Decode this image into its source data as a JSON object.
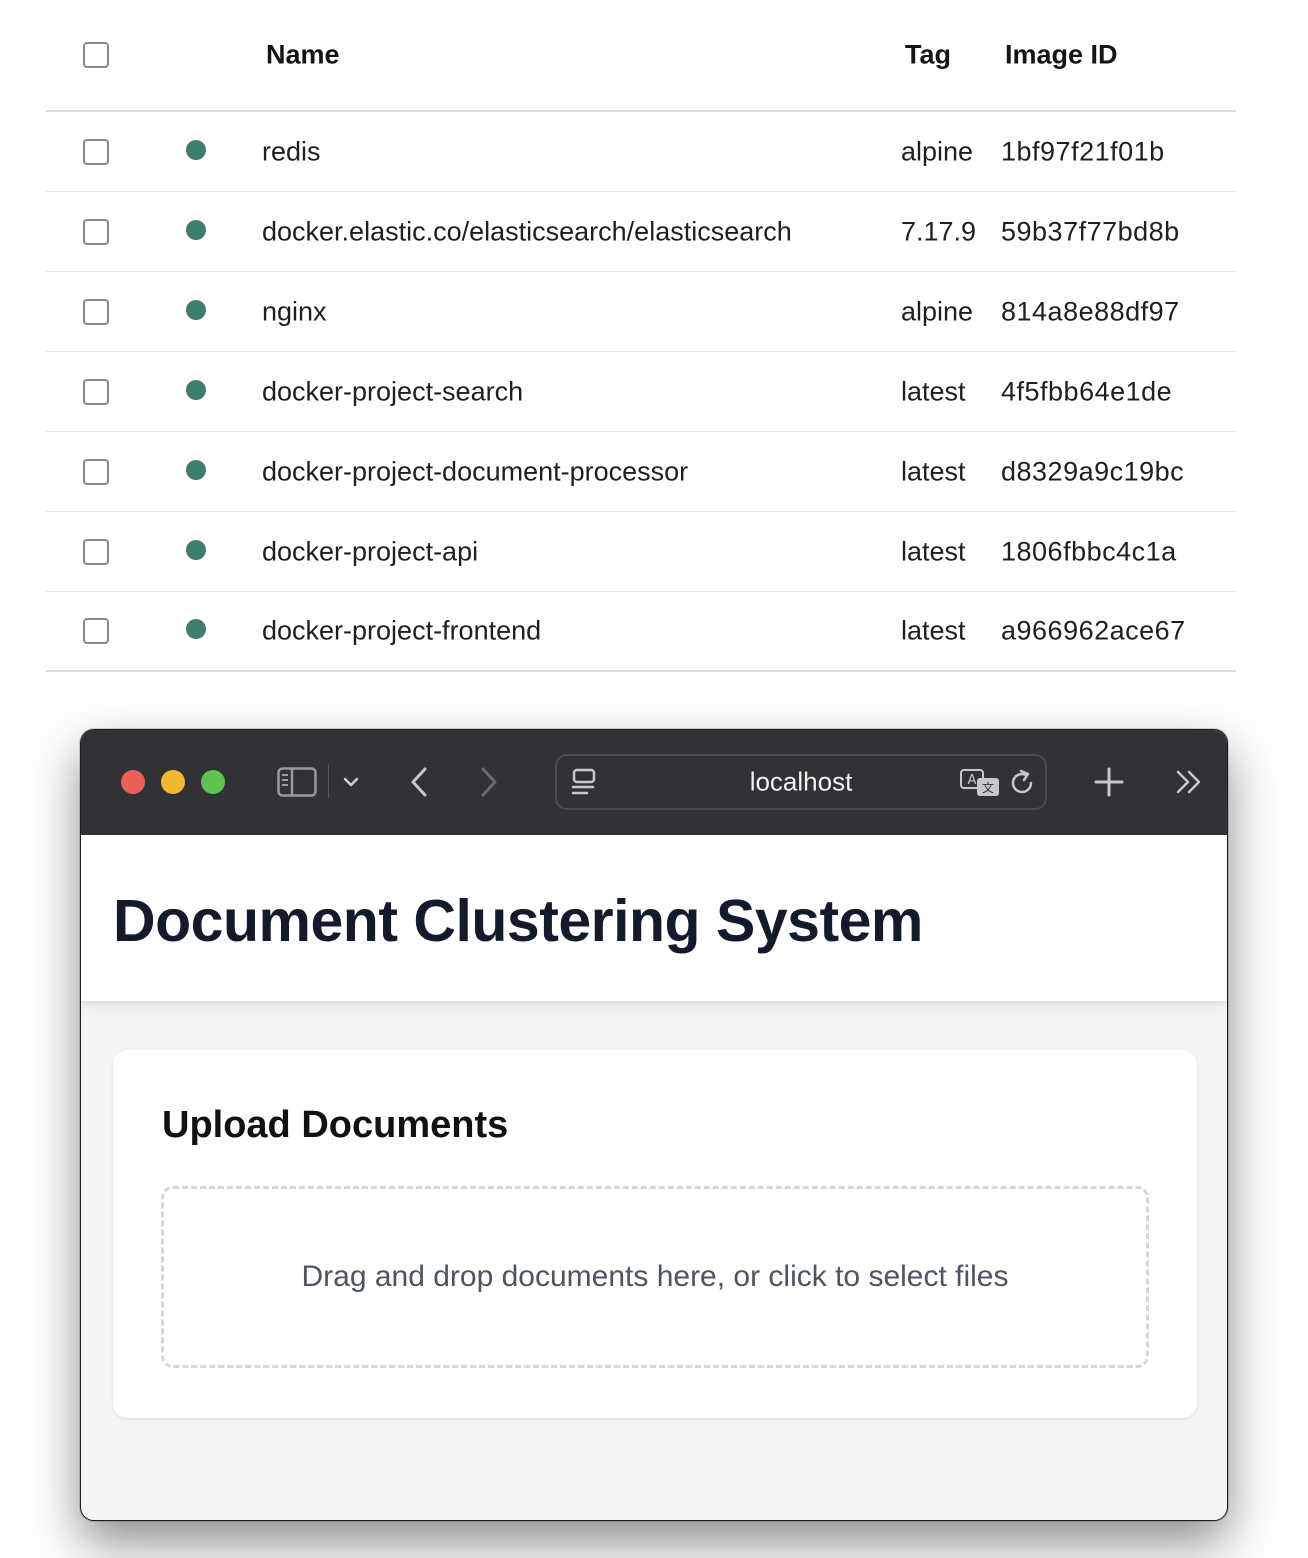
{
  "images_table": {
    "columns": {
      "name": "Name",
      "tag": "Tag",
      "image_id": "Image ID"
    },
    "status_color": "#3f7d70",
    "rows": [
      {
        "name": "redis",
        "tag": "alpine",
        "image_id": "1bf97f21f01b"
      },
      {
        "name": "docker.elastic.co/elasticsearch/elasticsearch",
        "tag": "7.17.9",
        "image_id": "59b37f77bd8b"
      },
      {
        "name": "nginx",
        "tag": "alpine",
        "image_id": "814a8e88df97"
      },
      {
        "name": "docker-project-search",
        "tag": "latest",
        "image_id": "4f5fbb64e1de"
      },
      {
        "name": "docker-project-document-processor",
        "tag": "latest",
        "image_id": "d8329a9c19bc"
      },
      {
        "name": "docker-project-api",
        "tag": "latest",
        "image_id": "1806fbbc4c1a"
      },
      {
        "name": "docker-project-frontend",
        "tag": "latest",
        "image_id": "a966962ace67"
      }
    ]
  },
  "browser": {
    "url": "localhost",
    "icons": [
      "sidebar-icon",
      "chevron-down-icon",
      "back-icon",
      "forward-icon",
      "page-icon",
      "translate-icon",
      "reload-icon",
      "plus-icon",
      "double-chevron-right-icon"
    ]
  },
  "app": {
    "title": "Document Clustering System",
    "upload": {
      "title": "Upload Documents",
      "dropzone_text": "Drag and drop documents here, or click to select files"
    }
  }
}
